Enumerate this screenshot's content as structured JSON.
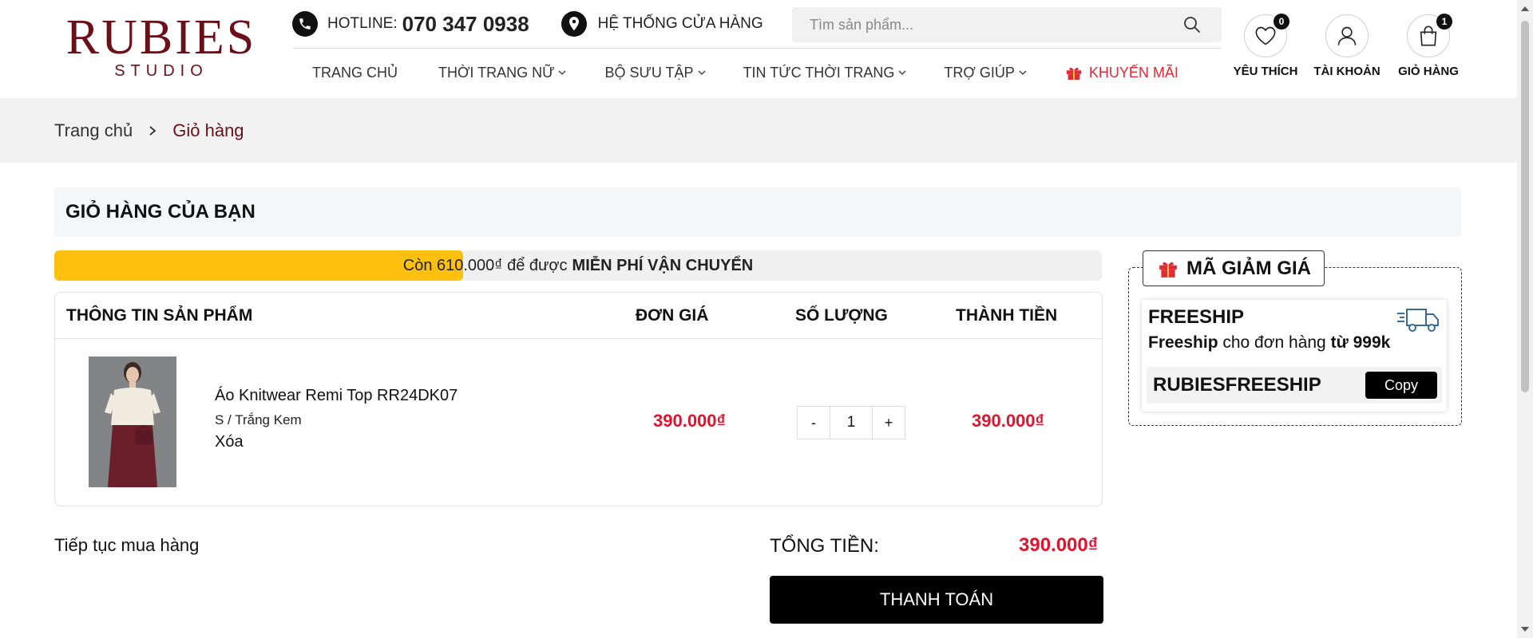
{
  "brand": {
    "name": "RUBIES",
    "sub": "STUDIO",
    "color": "#6b0f18"
  },
  "topbar": {
    "hotline_label": "HOTLINE:",
    "hotline_number": "070 347 0938",
    "stores_label": "HỆ THỐNG CỬA HÀNG"
  },
  "search": {
    "placeholder": "Tìm sản phẩm..."
  },
  "nav": {
    "items": [
      {
        "label": "TRANG CHỦ"
      },
      {
        "label": "THỜI TRANG NỮ"
      },
      {
        "label": "BỘ SƯU TẬP"
      },
      {
        "label": "TIN TỨC THỜI TRANG"
      },
      {
        "label": "TRỢ GIÚP"
      }
    ],
    "promo_label": "KHUYẾN MÃI",
    "promo_color": "#e32b37"
  },
  "user_menu": {
    "wishlist_label": "YÊU THÍCH",
    "wishlist_count": "0",
    "account_label": "TÀI KHOẢN",
    "cart_label": "GIỎ HÀNG",
    "cart_count": "1"
  },
  "breadcrumb": {
    "home": "Trang chủ",
    "current": "Giỏ hàng"
  },
  "cart": {
    "title": "GIỎ HÀNG CỦA BẠN",
    "shipping": {
      "text": "Còn 610.000₫ để được",
      "bold": "MIỄN PHÍ VẬN CHUYỂN",
      "progress": 0.39,
      "bar_color": "#fdc00f"
    },
    "columns": {
      "product": "THÔNG TIN SẢN PHẨM",
      "unit_price": "ĐƠN GIÁ",
      "quantity": "SỐ LƯỢNG",
      "subtotal": "THÀNH TIỀN"
    },
    "items": [
      {
        "name": "Áo Knitwear Remi Top RR24DK07",
        "variant": "S / Trắng Kem",
        "remove_label": "Xóa",
        "unit_price": "390.000₫",
        "quantity": "1",
        "subtotal": "390.000₫"
      }
    ],
    "qty_minus": "-",
    "qty_plus": "+",
    "continue_label": "Tiếp tục mua hàng",
    "total_label": "TỔNG TIỀN:",
    "total_value": "390.000₫",
    "checkout_label": "THANH TOÁN",
    "price_color": "#e0142f"
  },
  "coupon": {
    "heading": "MÃ GIẢM GIÁ",
    "title": "FREESHIP",
    "desc_bold1": "Freeship",
    "desc_mid": " cho đơn hàng ",
    "desc_bold2": "từ 999k",
    "code": "RUBIESFREESHIP",
    "copy_label": "Copy"
  }
}
